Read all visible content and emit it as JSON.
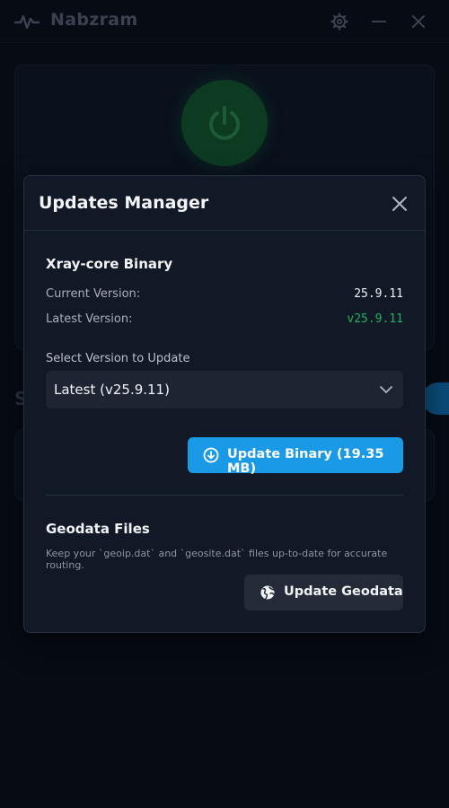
{
  "app": {
    "title": "Nabzram",
    "icons": {
      "logo": "pulse-icon",
      "settings": "gear-icon",
      "minimize": "minimize-icon",
      "close": "close-icon"
    }
  },
  "background": {
    "power_icon": "power-icon",
    "section_letter": "S"
  },
  "modal": {
    "title": "Updates Manager",
    "close_icon": "close-icon",
    "binary": {
      "section_title": "Xray-core Binary",
      "current_label": "Current Version:",
      "current_value": "25.9.11",
      "latest_label": "Latest Version:",
      "latest_value": "v25.9.11",
      "select_label": "Select Version to Update",
      "select_value": "Latest (v25.9.11)",
      "update_button": "Update Binary (19.35 MB)",
      "update_icon": "download-circle-icon"
    },
    "geodata": {
      "section_title": "Geodata Files",
      "description": "Keep your `geoip.dat` and `geosite.dat` files up-to-date for accurate routing.",
      "update_button": "Update Geodata",
      "update_icon": "globe-icon"
    }
  },
  "colors": {
    "accent": "#1a9ae6",
    "success": "#22b060",
    "modal_bg": "#111927",
    "app_bg": "#060b14"
  }
}
